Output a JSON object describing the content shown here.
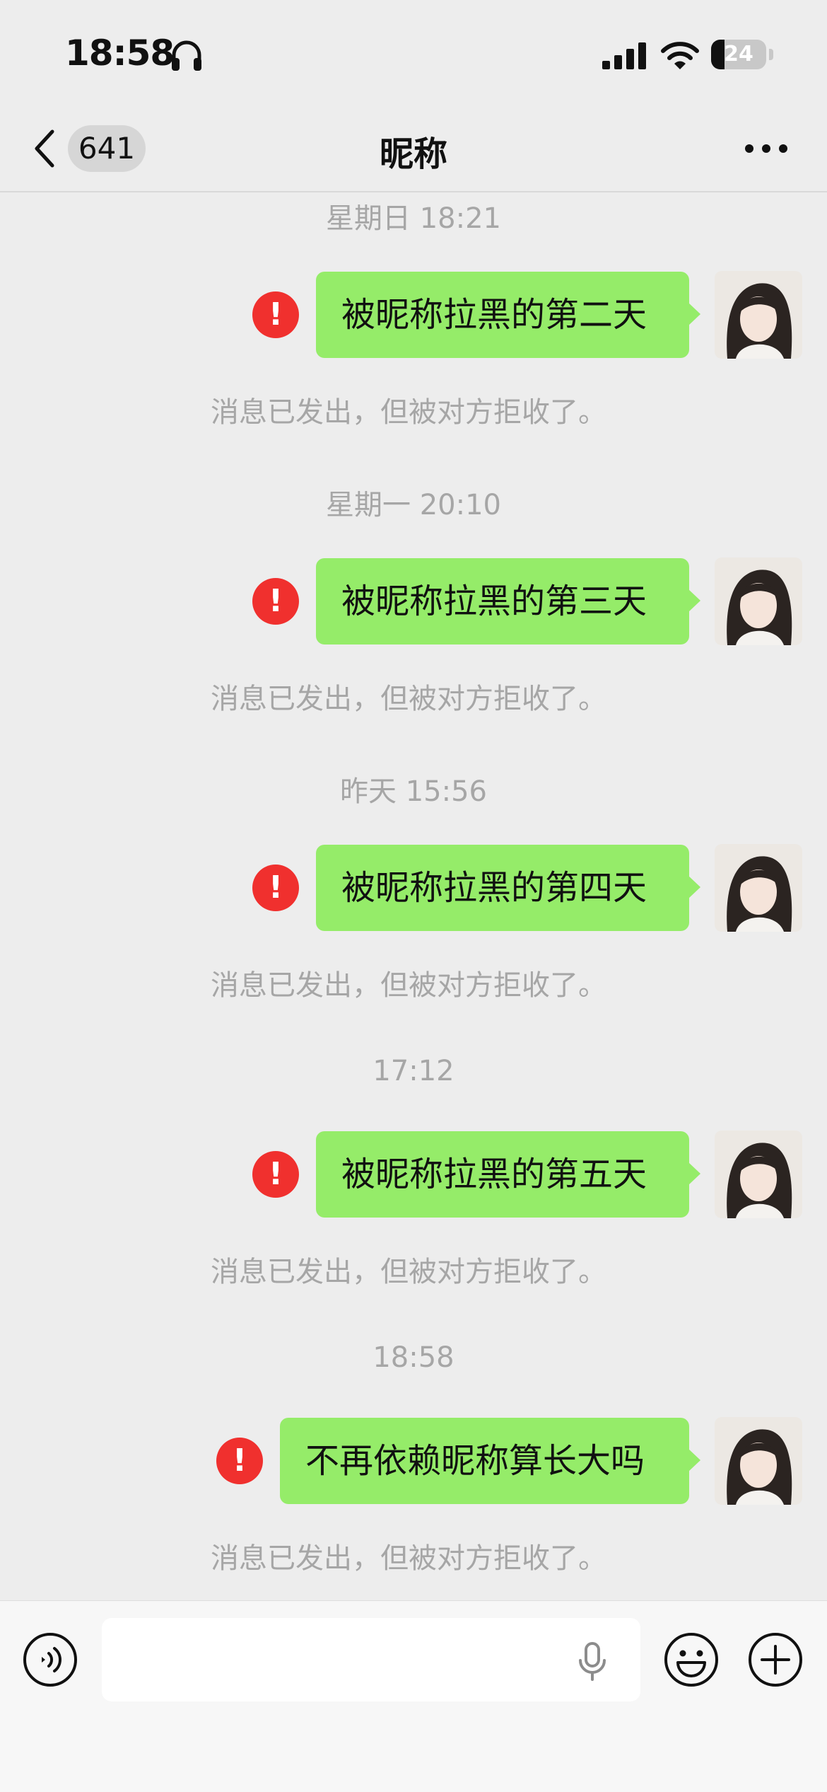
{
  "status_bar": {
    "time": "18:58",
    "battery": "24"
  },
  "nav": {
    "unread_count": "641",
    "title": "昵称"
  },
  "messages": [
    {
      "timestamp": "星期日 18:21",
      "text": "被昵称拉黑的第二天",
      "notice": "消息已发出，但被对方拒收了。"
    },
    {
      "timestamp": "星期一 20:10",
      "text": "被昵称拉黑的第三天",
      "notice": "消息已发出，但被对方拒收了。"
    },
    {
      "timestamp": "昨天 15:56",
      "text": "被昵称拉黑的第四天",
      "notice": "消息已发出，但被对方拒收了。"
    },
    {
      "timestamp": "17:12",
      "text": "被昵称拉黑的第五天",
      "notice": "消息已发出，但被对方拒收了。"
    },
    {
      "timestamp": "18:58",
      "text": "不再依赖昵称算长大吗",
      "notice": "消息已发出，但被对方拒收了。"
    }
  ],
  "error_glyph": "!",
  "input": {
    "value": "",
    "placeholder": ""
  },
  "icons": {
    "headphones": "headphones-icon",
    "signal": "cellular-signal-icon",
    "wifi": "wifi-icon",
    "back": "chevron-left-icon",
    "more": "more-icon",
    "voice": "voice-input-icon",
    "mic": "microphone-icon",
    "emoji": "emoji-icon",
    "plus": "plus-icon"
  },
  "colors": {
    "bubble": "#95ec69",
    "error": "#f0302e",
    "background": "#ededed"
  }
}
